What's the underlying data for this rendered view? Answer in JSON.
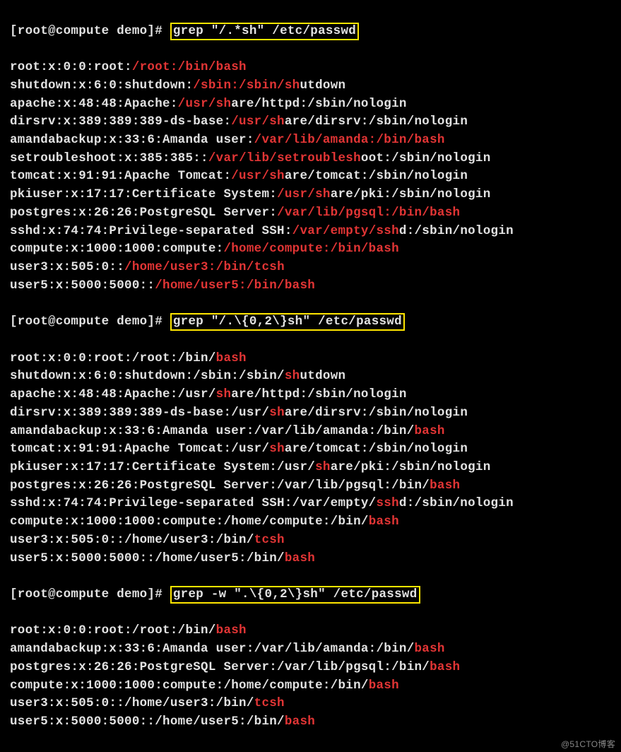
{
  "prompt": "[root@compute demo]# ",
  "commands": {
    "cmd1": "grep \"/.*sh\" /etc/passwd",
    "cmd2": "grep \"/.\\{0,2\\}sh\" /etc/passwd",
    "cmd3": "grep -w \".\\{0,2\\}sh\" /etc/passwd"
  },
  "block1": [
    {
      "pre": "root:x:0:0:root:",
      "hl": "/root:/bin/bash",
      "post": ""
    },
    {
      "pre": "shutdown:x:6:0:shutdown:",
      "hl": "/sbin:/sbin/sh",
      "post": "utdown"
    },
    {
      "pre": "apache:x:48:48:Apache:",
      "hl": "/usr/sh",
      "post": "are/httpd:/sbin/nologin"
    },
    {
      "pre": "dirsrv:x:389:389:389-ds-base:",
      "hl": "/usr/sh",
      "post": "are/dirsrv:/sbin/nologin"
    },
    {
      "pre": "amandabackup:x:33:6:Amanda user:",
      "hl": "/var/lib/amanda:/bin/bash",
      "post": ""
    },
    {
      "pre": "setroubleshoot:x:385:385::",
      "hl": "/var/lib/setroublesh",
      "post": "oot:/sbin/nologin"
    },
    {
      "pre": "tomcat:x:91:91:Apache Tomcat:",
      "hl": "/usr/sh",
      "post": "are/tomcat:/sbin/nologin"
    },
    {
      "pre": "pkiuser:x:17:17:Certificate System:",
      "hl": "/usr/sh",
      "post": "are/pki:/sbin/nologin"
    },
    {
      "pre": "postgres:x:26:26:PostgreSQL Server:",
      "hl": "/var/lib/pgsql:/bin/bash",
      "post": ""
    },
    {
      "pre": "sshd:x:74:74:Privilege-separated SSH:",
      "hl": "/var/empty/ssh",
      "post": "d:/sbin/nologin"
    },
    {
      "pre": "compute:x:1000:1000:compute:",
      "hl": "/home/compute:/bin/bash",
      "post": ""
    },
    {
      "pre": "user3:x:505:0::",
      "hl": "/home/user3:/bin/tcsh",
      "post": ""
    },
    {
      "pre": "user5:x:5000:5000::",
      "hl": "/home/user5:/bin/bash",
      "post": ""
    }
  ],
  "block2": [
    {
      "pre": "root:x:0:0:root:/root:/bin/",
      "hl": "bash",
      "post": ""
    },
    {
      "pre": "shutdown:x:6:0:shutdown:/sbin:/sbin/",
      "hl": "sh",
      "post": "utdown"
    },
    {
      "pre": "apache:x:48:48:Apache:/usr/",
      "hl": "sh",
      "post": "are/httpd:/sbin/nologin"
    },
    {
      "pre": "dirsrv:x:389:389:389-ds-base:/usr/",
      "hl": "sh",
      "post": "are/dirsrv:/sbin/nologin"
    },
    {
      "pre": "amandabackup:x:33:6:Amanda user:/var/lib/amanda:/bin/",
      "hl": "bash",
      "post": ""
    },
    {
      "pre": "tomcat:x:91:91:Apache Tomcat:/usr/",
      "hl": "sh",
      "post": "are/tomcat:/sbin/nologin"
    },
    {
      "pre": "pkiuser:x:17:17:Certificate System:/usr/",
      "hl": "sh",
      "post": "are/pki:/sbin/nologin"
    },
    {
      "pre": "postgres:x:26:26:PostgreSQL Server:/var/lib/pgsql:/bin/",
      "hl": "bash",
      "post": ""
    },
    {
      "pre": "sshd:x:74:74:Privilege-separated SSH:/var/empty/",
      "hl": "ssh",
      "post": "d:/sbin/nologin"
    },
    {
      "pre": "compute:x:1000:1000:compute:/home/compute:/bin/",
      "hl": "bash",
      "post": ""
    },
    {
      "pre": "user3:x:505:0::/home/user3:/bin/",
      "hl": "tcsh",
      "post": ""
    },
    {
      "pre": "user5:x:5000:5000::/home/user5:/bin/",
      "hl": "bash",
      "post": ""
    }
  ],
  "block3": [
    {
      "pre": "root:x:0:0:root:/root:/bin/",
      "hl": "bash",
      "post": ""
    },
    {
      "pre": "amandabackup:x:33:6:Amanda user:/var/lib/amanda:/bin/",
      "hl": "bash",
      "post": ""
    },
    {
      "pre": "postgres:x:26:26:PostgreSQL Server:/var/lib/pgsql:/bin/",
      "hl": "bash",
      "post": ""
    },
    {
      "pre": "compute:x:1000:1000:compute:/home/compute:/bin/",
      "hl": "bash",
      "post": ""
    },
    {
      "pre": "user3:x:505:0::/home/user3:/bin/",
      "hl": "tcsh",
      "post": ""
    },
    {
      "pre": "user5:x:5000:5000::/home/user5:/bin/",
      "hl": "bash",
      "post": ""
    }
  ],
  "watermark": "@51CTO博客"
}
